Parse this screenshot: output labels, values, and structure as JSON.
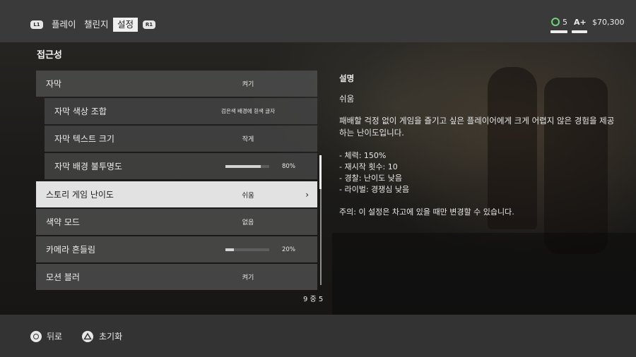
{
  "top_nav": {
    "l1": "L1",
    "r1": "R1",
    "tabs": [
      "플레이",
      "챌린지",
      "설정"
    ],
    "active_tab": 2
  },
  "stats": {
    "coins": "5",
    "rating_icon": "A+",
    "money": "$70,300",
    "coin_color": "#6fd37a"
  },
  "page": {
    "title": "접근성"
  },
  "menu": {
    "items": [
      {
        "label": "자막",
        "value": "켜기"
      },
      {
        "label": "자막 색상 조합",
        "value": "검은색 배경에 흰색 글자"
      },
      {
        "label": "자막 텍스트 크기",
        "value": "작게"
      },
      {
        "label": "자막 배경 불투명도",
        "slider": 0.8,
        "value": "80%"
      },
      {
        "label": "스토리 게임 난이도",
        "value": "쉬움"
      },
      {
        "label": "색약 모드",
        "value": "없음"
      },
      {
        "label": "카메라 흔들림",
        "slider": 0.2,
        "value": "20%"
      },
      {
        "label": "모션 블러",
        "value": "켜기"
      }
    ],
    "pagination": "9 중 5"
  },
  "description": {
    "heading": "설명",
    "selected": "쉬움",
    "body": "패배할 걱정 없이 게임을 즐기고 싶은 플레이어에게 크게 어렵지 않은 경험을 제공하는 난이도입니다.",
    "stats": [
      "- 체력: 150%",
      "- 재시작 횟수: 10",
      "- 경찰: 난이도 낮음",
      "- 라이벌: 경쟁심 낮음"
    ],
    "note": "주의: 이 설정은 차고에 있을 때만 변경할 수 있습니다."
  },
  "bottom": {
    "back_label": "뒤로",
    "reset_label": "초기화"
  }
}
